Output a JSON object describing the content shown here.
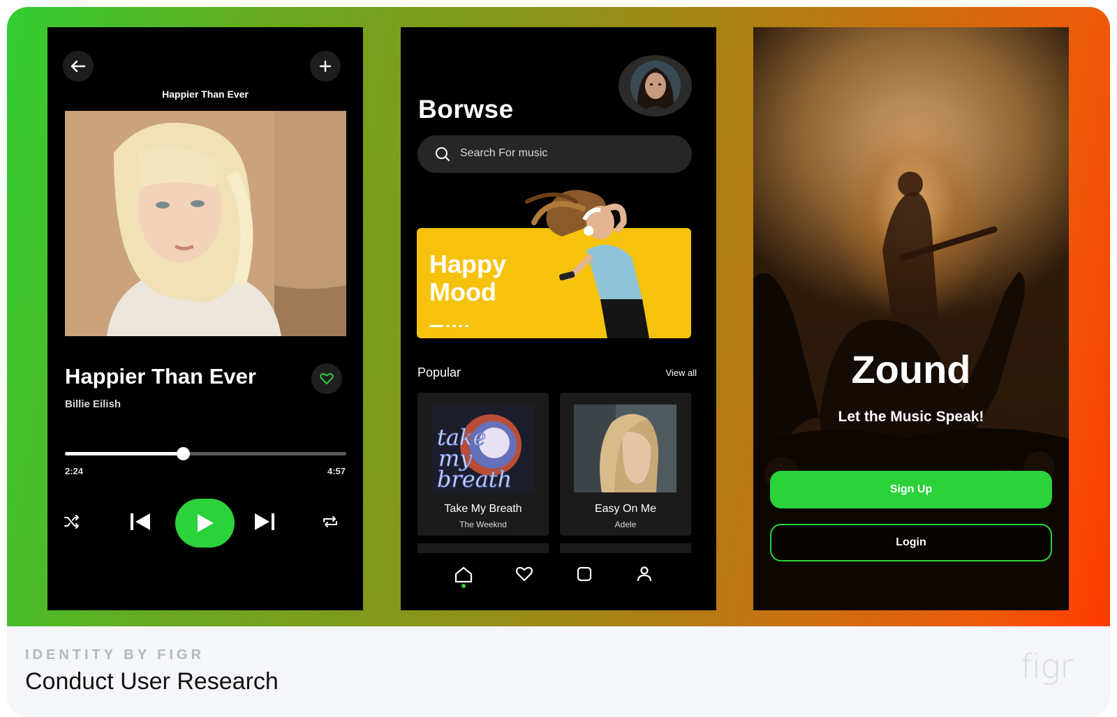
{
  "player": {
    "header_title": "Happier Than Ever",
    "song_title": "Happier Than Ever",
    "artist": "Billie Eilish",
    "elapsed": "2:24",
    "duration": "4:57",
    "progress_fraction": 0.42,
    "icons": [
      "back-arrow-icon",
      "plus-icon",
      "heart-icon",
      "shuffle-icon",
      "previous-icon",
      "play-icon",
      "next-icon",
      "repeat-icon"
    ],
    "accent": "#2bd23a"
  },
  "browse": {
    "title": "Borwse",
    "search_placeholder": "Search For music",
    "banner_line1": "Happy",
    "banner_line2": "Mood",
    "banner_color": "#f6c20b",
    "section_title": "Popular",
    "view_all": "View all",
    "tiles": [
      {
        "name": "Take My Breath",
        "artist": "The Weeknd",
        "cover_text": [
          "take",
          "my",
          "breath"
        ]
      },
      {
        "name": "Easy On Me",
        "artist": "Adele"
      }
    ],
    "nav": [
      "home-icon",
      "heart-icon",
      "library-icon",
      "profile-icon"
    ]
  },
  "splash": {
    "brand": "Zound",
    "tagline": "Let the Music Speak!",
    "signup": "Sign Up",
    "login": "Login"
  },
  "caption": {
    "kicker": "IDENTITY BY FIGR",
    "title": "Conduct User Research",
    "logo": "figr"
  }
}
